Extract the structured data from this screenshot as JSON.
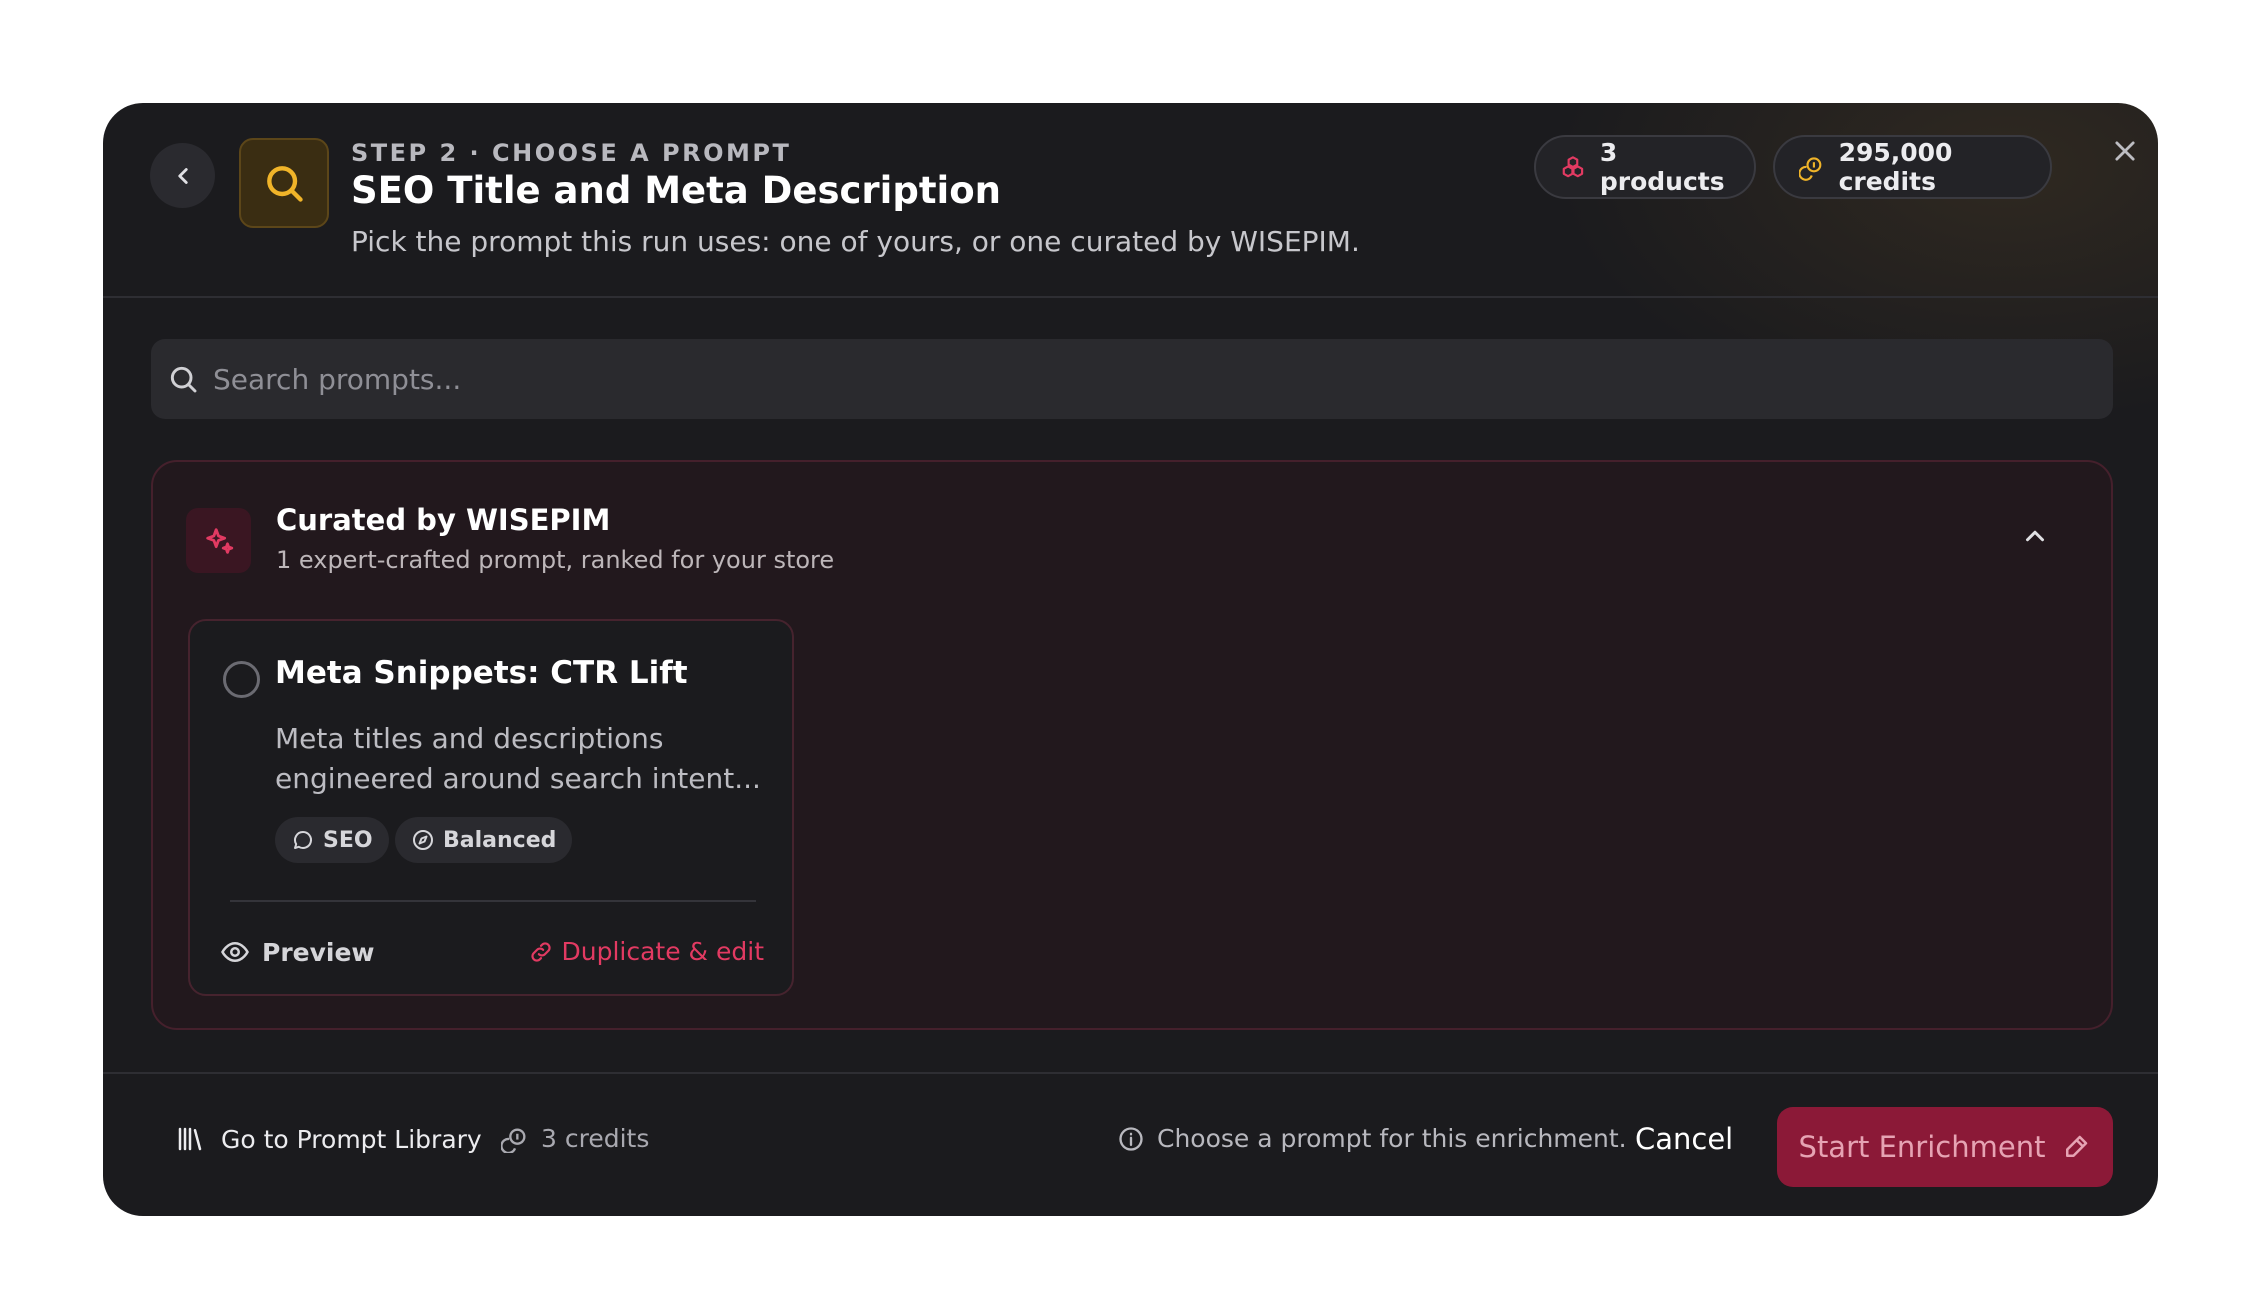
{
  "header": {
    "step_label": "STEP 2 · CHOOSE A PROMPT",
    "title": "SEO Title and Meta Description",
    "subtitle": "Pick the prompt this run uses: one of yours, or one curated by WISEPIM.",
    "products_pill": "3 products",
    "credits_pill": "295,000 credits"
  },
  "search": {
    "placeholder": "Search prompts..."
  },
  "curated": {
    "title": "Curated by WISEPIM",
    "subtitle": "1 expert-crafted prompt, ranked for your store",
    "prompts": [
      {
        "title": "Meta Snippets: CTR Lift",
        "description": "Meta titles and descriptions engineered around search intent...",
        "tags": [
          "SEO",
          "Balanced"
        ],
        "preview_label": "Preview",
        "duplicate_label": "Duplicate & edit"
      }
    ]
  },
  "footer": {
    "library_link": "Go to Prompt Library",
    "credits_cost": "3 credits",
    "hint": "Choose a prompt for this enrichment.",
    "cancel_label": "Cancel",
    "start_label": "Start Enrichment"
  },
  "colors": {
    "accent": "#e23a62",
    "primary_button": "#8b1937",
    "gold_icon": "#f0b429"
  }
}
